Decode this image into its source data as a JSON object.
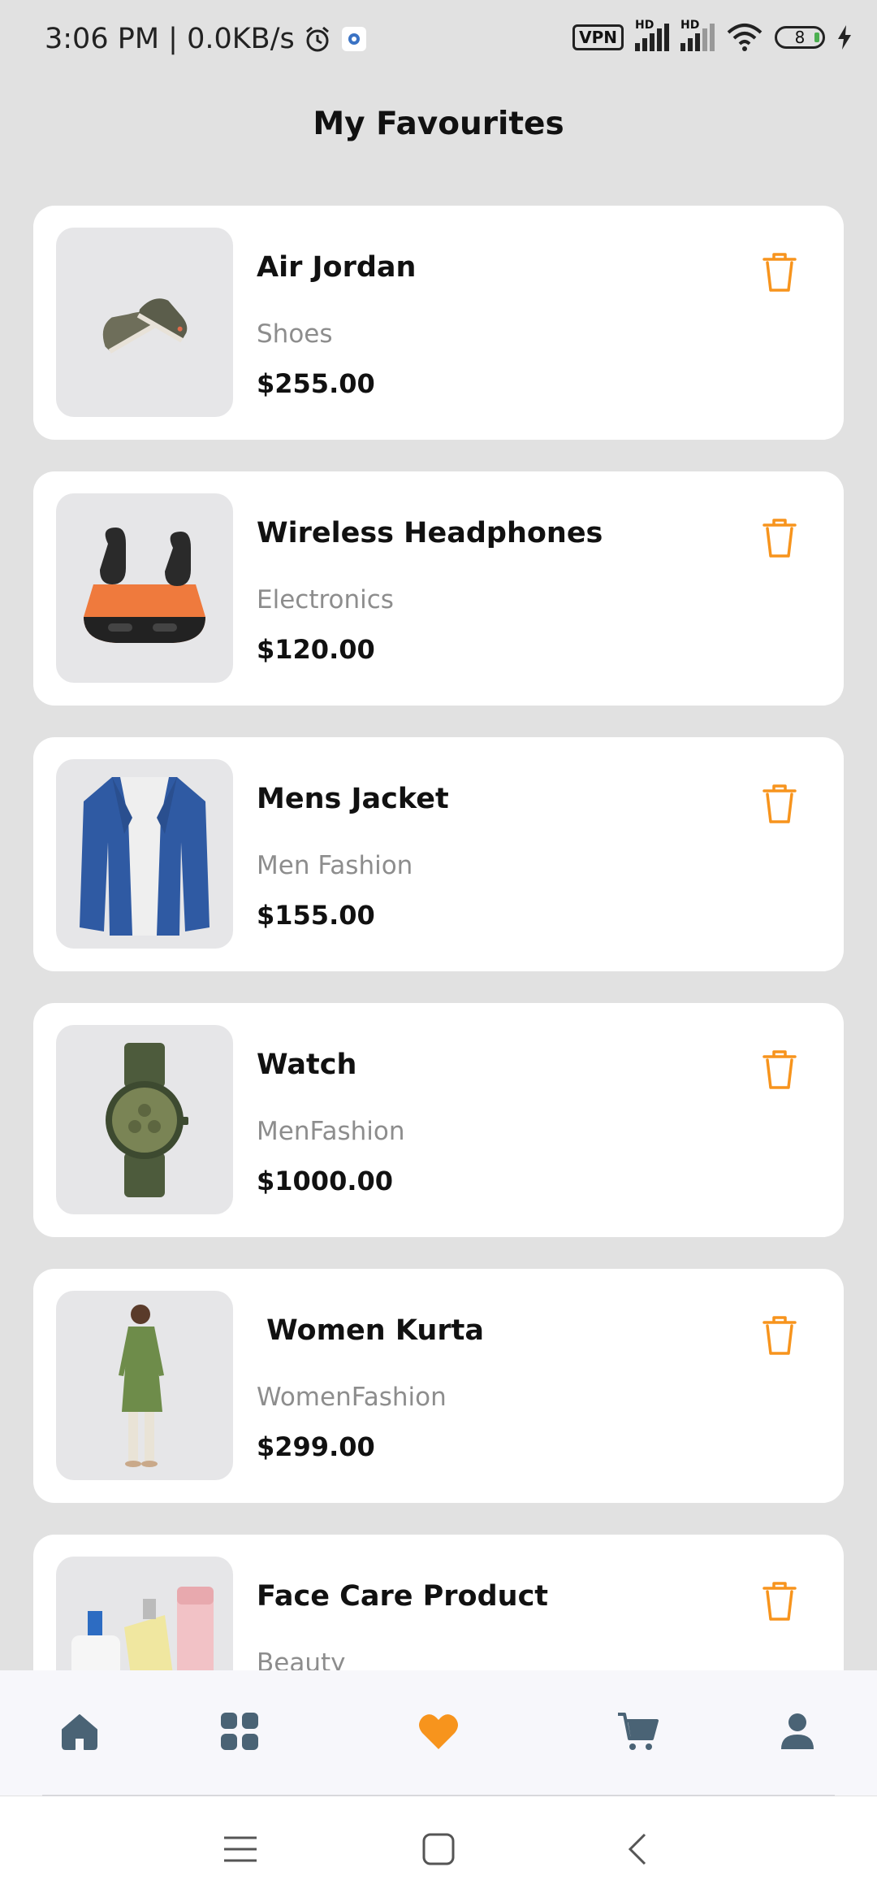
{
  "status": {
    "time": "3:06 PM | 0.0KB/s",
    "vpn": "VPN",
    "hd1": "HD",
    "hd2": "HD",
    "battery": "8"
  },
  "title": "My Favourites",
  "items": [
    {
      "name": "Air Jordan",
      "category": "Shoes",
      "price": "$255.00",
      "image_icon": "sneakers-image"
    },
    {
      "name": "Wireless Headphones",
      "category": "Electronics",
      "price": "$120.00",
      "image_icon": "earbuds-image"
    },
    {
      "name": "Mens Jacket",
      "category": "Men Fashion",
      "price": "$155.00",
      "image_icon": "jacket-image"
    },
    {
      "name": "Watch",
      "category": "MenFashion",
      "price": "$1000.00",
      "image_icon": "watch-image"
    },
    {
      "name": " Women Kurta",
      "category": "WomenFashion",
      "price": "$299.00",
      "image_icon": "kurta-image"
    },
    {
      "name": "Face Care Product",
      "category": "Beauty",
      "price": "",
      "image_icon": "skincare-image"
    }
  ],
  "nav": {
    "items": [
      "home-icon",
      "grid-icon",
      "heart-icon",
      "cart-icon",
      "profile-icon"
    ],
    "active": "heart-icon"
  },
  "colors": {
    "accent": "#f7941d",
    "nav_icon": "#4a6375",
    "background": "#e1e1e1",
    "card": "#ffffff"
  }
}
